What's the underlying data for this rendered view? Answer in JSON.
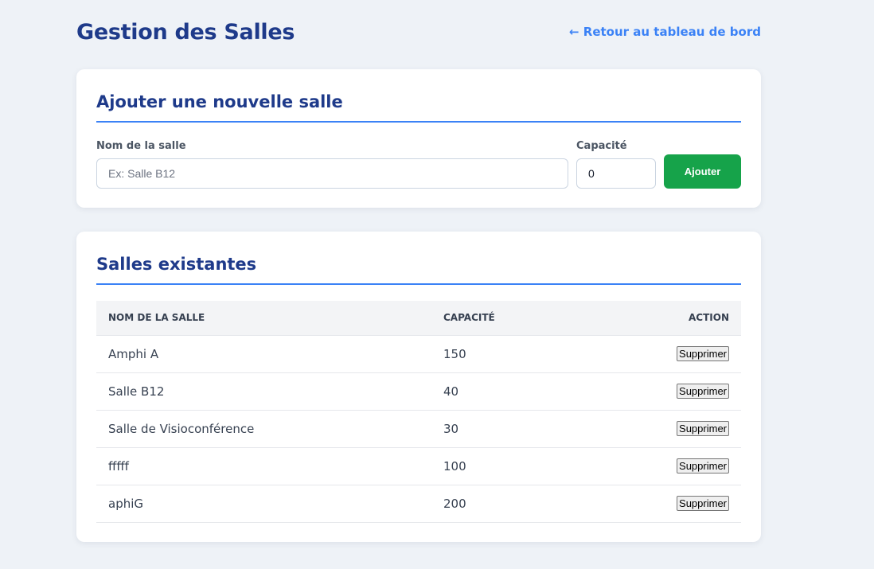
{
  "header": {
    "title": "Gestion des Salles",
    "back_link": "← Retour au tableau de bord"
  },
  "add_form": {
    "title": "Ajouter une nouvelle salle",
    "name_label": "Nom de la salle",
    "name_placeholder": "Ex: Salle B12",
    "name_value": "",
    "capacity_label": "Capacité",
    "capacity_value": "0",
    "submit_label": "Ajouter"
  },
  "rooms": {
    "title": "Salles existantes",
    "columns": [
      "Nom de la salle",
      "Capacité",
      "Action"
    ],
    "rows": [
      {
        "name": "Amphi A",
        "capacity": "150",
        "action": "Supprimer"
      },
      {
        "name": "Salle B12",
        "capacity": "40",
        "action": "Supprimer"
      },
      {
        "name": "Salle de Visioconférence",
        "capacity": "30",
        "action": "Supprimer"
      },
      {
        "name": "fffff",
        "capacity": "100",
        "action": "Supprimer"
      },
      {
        "name": "aphiG",
        "capacity": "200",
        "action": "Supprimer"
      }
    ]
  },
  "colors": {
    "background": "#eef2f7",
    "title": "#1e3a8a",
    "accent": "#3b82f6",
    "add_button": "#16a34a"
  }
}
